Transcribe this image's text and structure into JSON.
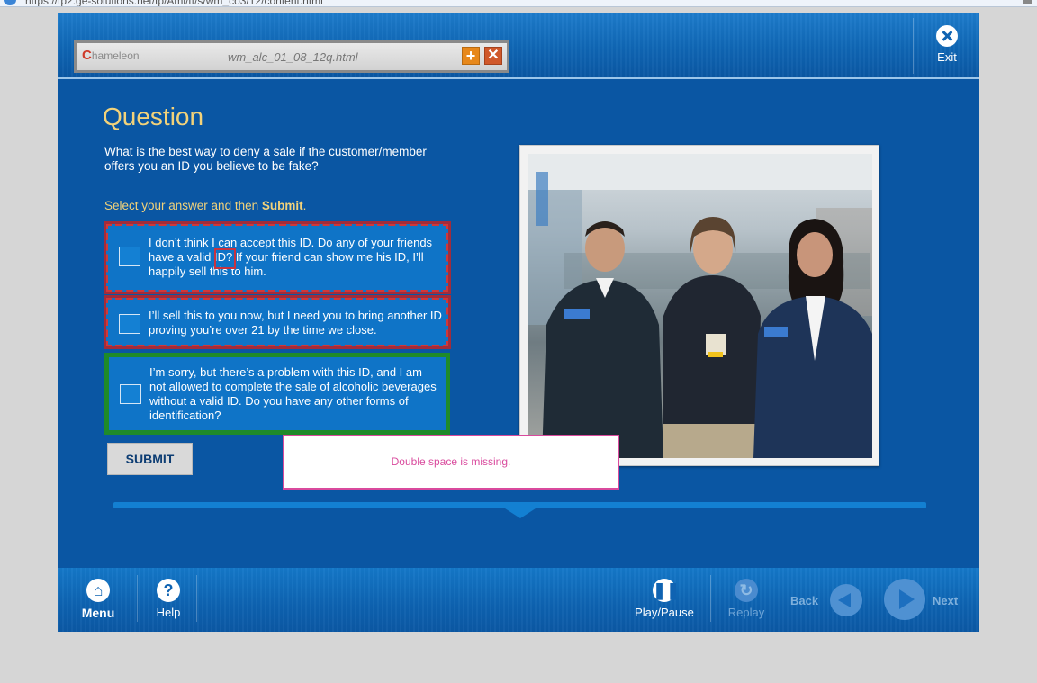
{
  "browser": {
    "url": "https://tp2.ge-solutions.net/tp/Ami/tt/s/wm_co3/12/content.html"
  },
  "chameleon": {
    "logo_text": "hameleon",
    "logo_letter": "C",
    "filename": "wm_alc_01_08_12q.html",
    "add_label": "+",
    "close_label": "✕"
  },
  "header": {
    "exit_label": "Exit"
  },
  "question": {
    "title": "Question",
    "text": "What is the best way to deny a sale if the customer/member offers you an ID you believe to be fake?",
    "instruction_prefix": "Select your answer and then ",
    "instruction_bold": "Submit",
    "instruction_suffix": ".",
    "options": [
      {
        "text": "I don’t think I can accept this ID.  Do any of your friends have a valid ID? If your friend can show me his ID, I’ll happily sell this to him."
      },
      {
        "text": "I’ll sell this to you now, but I need you to bring another ID proving you’re over 21 by the time we close."
      },
      {
        "text": "I’m sorry, but there’s a problem with this ID, and I am not allowed to complete the sale of alcoholic beverages without a valid ID.  Do you have any other forms of identification?"
      }
    ],
    "submit_label": "SUBMIT"
  },
  "review_note": {
    "text": "Double space is missing."
  },
  "footer": {
    "menu_label": "Menu",
    "help_label": "Help",
    "play_pause_label": "Play/Pause",
    "replay_label": "Replay",
    "back_label": "Back",
    "next_label": "Next"
  },
  "colors": {
    "course_blue": "#0a56a3",
    "title_gold": "#f2d27a",
    "option_blue": "#0f74c7",
    "wrong_red": "#d0383a",
    "correct_green": "#1f8a2a",
    "note_pink": "#d94a9d"
  }
}
